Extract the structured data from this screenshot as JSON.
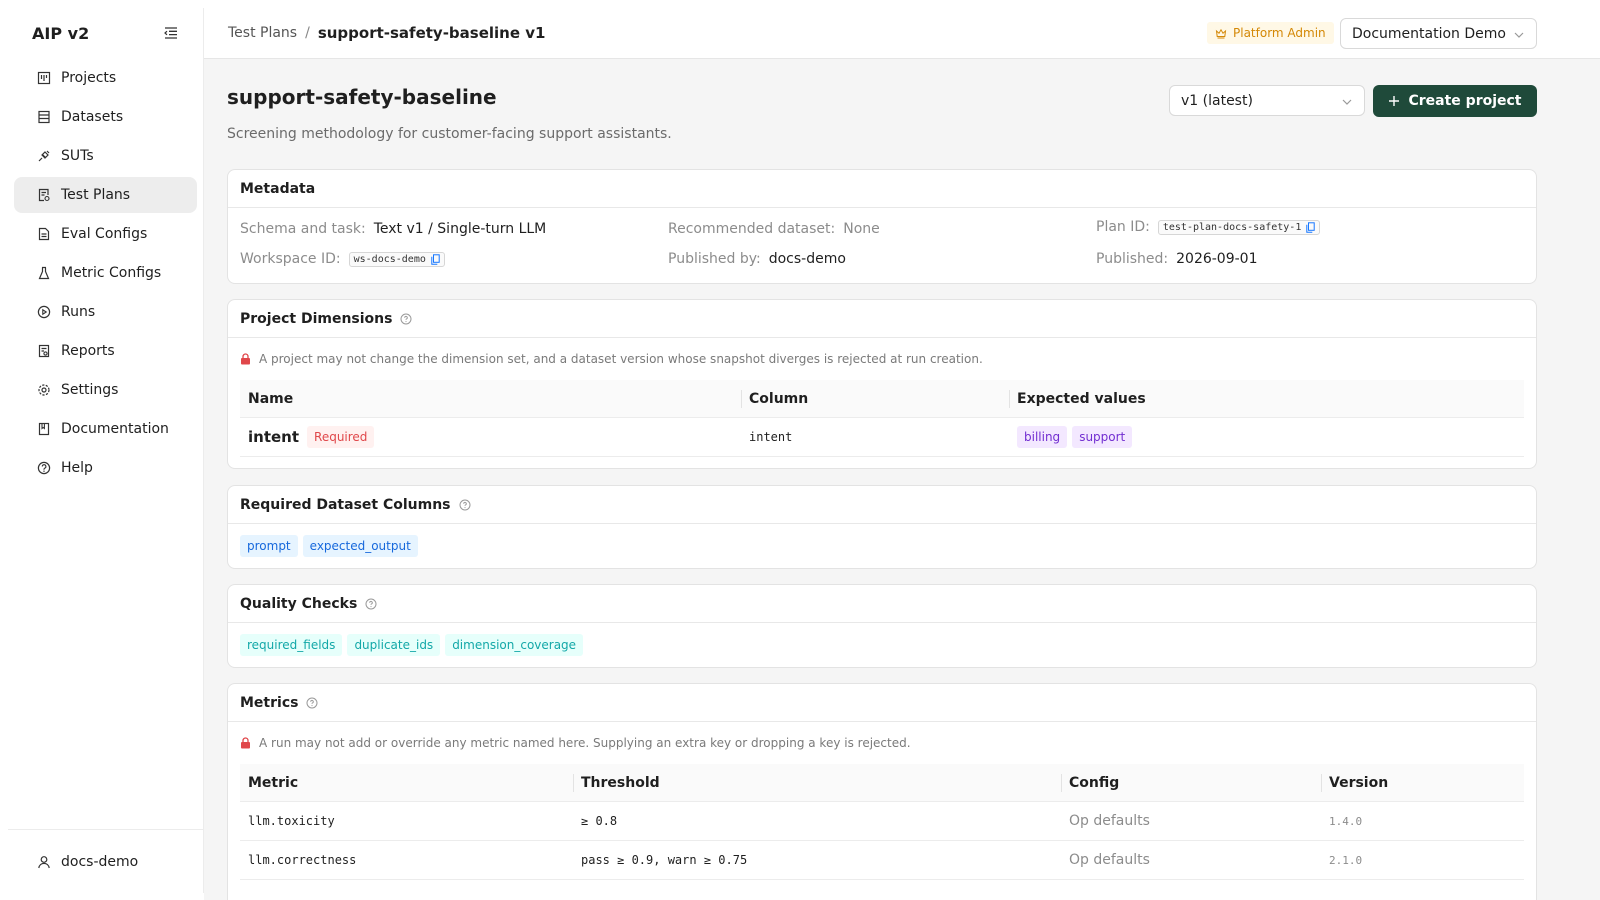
{
  "app": {
    "title": "AIP v2",
    "nav": [
      {
        "label": "Projects",
        "icon": "projects-icon"
      },
      {
        "label": "Datasets",
        "icon": "datasets-icon"
      },
      {
        "label": "SUTs",
        "icon": "sut-icon"
      },
      {
        "label": "Test Plans",
        "icon": "test-plans-icon",
        "active": true
      },
      {
        "label": "Eval Configs",
        "icon": "eval-configs-icon"
      },
      {
        "label": "Metric Configs",
        "icon": "metric-configs-icon"
      },
      {
        "label": "Runs",
        "icon": "runs-icon"
      },
      {
        "label": "Reports",
        "icon": "reports-icon"
      },
      {
        "label": "Settings",
        "icon": "settings-icon"
      },
      {
        "label": "Documentation",
        "icon": "documentation-icon"
      },
      {
        "label": "Help",
        "icon": "help-icon"
      }
    ],
    "user": "docs-demo"
  },
  "header": {
    "breadcrumb_parent": "Test Plans",
    "breadcrumb_separator": "/",
    "breadcrumb_current": "support-safety-baseline v1",
    "role_badge": "Platform Admin",
    "workspace": "Documentation Demo"
  },
  "page": {
    "title": "support-safety-baseline",
    "description": "Screening methodology for customer-facing support assistants.",
    "version_selected": "v1 (latest)",
    "create_button": "Create project"
  },
  "metadata": {
    "title": "Metadata",
    "schema_label": "Schema and task:",
    "schema_value": "Text v1 / Single-turn LLM",
    "recommended_label": "Recommended dataset:",
    "recommended_value": "None",
    "plan_id_label": "Plan ID:",
    "plan_id_value": "test-plan-docs-safety-1",
    "workspace_id_label": "Workspace ID:",
    "workspace_id_value": "ws-docs-demo",
    "published_by_label": "Published by:",
    "published_by_value": "docs-demo",
    "published_label": "Published:",
    "published_value": "2026-09-01"
  },
  "dimensions": {
    "title": "Project Dimensions",
    "notice": "A project may not change the dimension set, and a dataset version whose snapshot diverges is rejected at run creation.",
    "columns": [
      "Name",
      "Column",
      "Expected values"
    ],
    "rows": [
      {
        "name": "intent",
        "required": "Required",
        "column": "intent",
        "values": [
          "billing",
          "support"
        ]
      }
    ]
  },
  "required_columns": {
    "title": "Required Dataset Columns",
    "tags": [
      "prompt",
      "expected_output"
    ]
  },
  "quality_checks": {
    "title": "Quality Checks",
    "tags": [
      "required_fields",
      "duplicate_ids",
      "dimension_coverage"
    ]
  },
  "metrics": {
    "title": "Metrics",
    "notice": "A run may not add or override any metric named here. Supplying an extra key or dropping a key is rejected.",
    "columns": [
      "Metric",
      "Threshold",
      "Config",
      "Version"
    ],
    "rows": [
      {
        "metric": "llm.toxicity",
        "threshold": "≥ 0.8",
        "config": "Op defaults",
        "version": "1.4.0"
      },
      {
        "metric": "llm.correctness",
        "threshold": "pass ≥ 0.9, warn ≥ 0.75",
        "config": "Op defaults",
        "version": "2.1.0"
      }
    ]
  },
  "colors": {
    "primary_button": "#1f4a3a",
    "admin_badge": "#d48806",
    "required_tag": "#e0474a",
    "lock_icon": "#e0474a"
  }
}
